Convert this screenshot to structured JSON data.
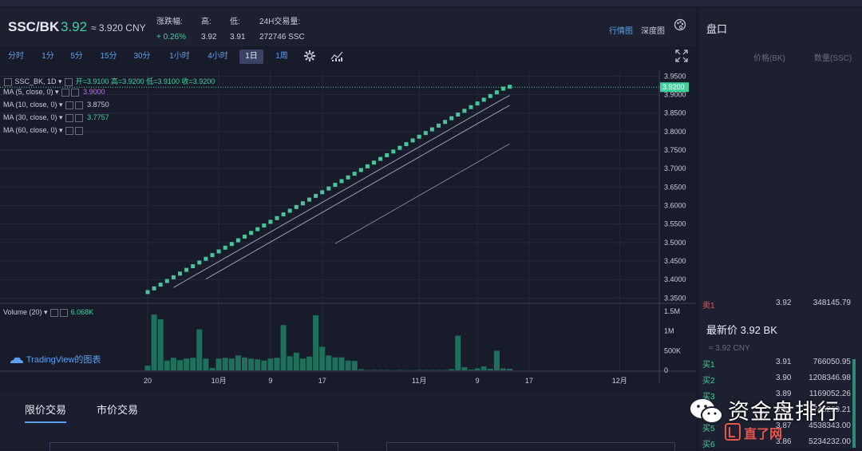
{
  "header": {
    "pair": "SSC/BK",
    "last_price": "3.92",
    "cny": "≈ 3.920 CNY",
    "stats": [
      {
        "k": "涨跌幅:",
        "v": "+ 0.26%",
        "up": true,
        "x": 196
      },
      {
        "k": "高:",
        "v": "3.92",
        "x": 252
      },
      {
        "k": "低:",
        "v": "3.91",
        "x": 288
      },
      {
        "k": "24H交易量:",
        "v": "272746 SSC",
        "x": 325
      }
    ],
    "view_links": [
      {
        "label": "行情图",
        "active": true
      },
      {
        "label": "深度图",
        "active": false
      }
    ],
    "palette_icon": "palette-icon"
  },
  "timeframes": [
    "分时",
    "1分",
    "5分",
    "15分",
    "30分",
    "1小时",
    "4小时",
    "1日",
    "1周"
  ],
  "selected_timeframe": "1日",
  "legend": {
    "symbol": "SSC_BK, 1D",
    "ohlc": "开=3.9100  高=3.9200  低=3.9100  收=3.9200",
    "ma": [
      {
        "label": "MA (5, close, 0)",
        "value": "3.9000",
        "color": "#c06cf0"
      },
      {
        "label": "MA (10, close, 0)",
        "value": "3.8750",
        "color": "#c9ccd8"
      },
      {
        "label": "MA (30, close, 0)",
        "value": "3.7757",
        "color": "#3fd19c"
      },
      {
        "label": "MA (60, close, 0)",
        "value": ""
      }
    ],
    "volume_label": "Volume (20)",
    "volume_value": "6.068K"
  },
  "tradingview": "TradingView的图表",
  "chart_data": {
    "type": "candlestick",
    "price_axis": {
      "ticks": [
        "3.9500",
        "3.9000",
        "3.8500",
        "3.8000",
        "3.7500",
        "3.7000",
        "3.6500",
        "3.6000",
        "3.5500",
        "3.5000",
        "3.4500",
        "3.4000",
        "3.3500"
      ],
      "ylim": [
        3.34,
        3.955
      ]
    },
    "current_price_label": "3.9200",
    "volume_axis": {
      "ticks": [
        "1.5M",
        "1M",
        "500K",
        "0"
      ],
      "ylim": [
        0,
        1500000
      ]
    },
    "x_labels": [
      {
        "label": "20",
        "index": 0
      },
      {
        "label": "10月",
        "index": 11
      },
      {
        "label": "9",
        "index": 19
      },
      {
        "label": "17",
        "index": 27
      },
      {
        "label": "11月",
        "index": 42
      },
      {
        "label": "9",
        "index": 51
      },
      {
        "label": "17",
        "index": 59
      },
      {
        "label": "12月",
        "index": 73
      }
    ],
    "closes": [
      3.365,
      3.375,
      3.385,
      3.395,
      3.405,
      3.415,
      3.425,
      3.435,
      3.445,
      3.455,
      3.465,
      3.475,
      3.485,
      3.495,
      3.505,
      3.515,
      3.525,
      3.535,
      3.545,
      3.555,
      3.565,
      3.575,
      3.585,
      3.595,
      3.605,
      3.615,
      3.625,
      3.635,
      3.645,
      3.655,
      3.665,
      3.675,
      3.685,
      3.695,
      3.705,
      3.715,
      3.725,
      3.735,
      3.745,
      3.755,
      3.765,
      3.775,
      3.785,
      3.795,
      3.805,
      3.815,
      3.825,
      3.835,
      3.845,
      3.855,
      3.865,
      3.875,
      3.885,
      3.895,
      3.905,
      3.915,
      3.92
    ],
    "volumes": [
      120000,
      1420000,
      1300000,
      250000,
      320000,
      260000,
      300000,
      320000,
      1040000,
      300000,
      60000,
      300000,
      320000,
      300000,
      380000,
      330000,
      300000,
      280000,
      250000,
      300000,
      320000,
      1150000,
      360000,
      450000,
      300000,
      350000,
      1400000,
      600000,
      380000,
      330000,
      330000,
      250000,
      240000,
      30000,
      10000,
      10000,
      10000,
      10000,
      5000,
      10000,
      5000,
      5000,
      10000,
      10000,
      10000,
      10000,
      10000,
      30000,
      880000,
      80000,
      20000,
      50000,
      100000,
      40000,
      500000,
      50000,
      40000
    ]
  },
  "bottom": {
    "tabs": [
      "限价交易",
      "市价交易"
    ]
  },
  "orderbook": {
    "title": "盘口",
    "col_price": "价格(BK)",
    "col_qty": "数量(SSC)",
    "sell": [
      {
        "label": "卖1",
        "price": "3.92",
        "qty": "348145.79"
      }
    ],
    "last": "最新价 3.92 BK",
    "last_cny": "≈ 3.92 CNY",
    "buy": [
      {
        "label": "买1",
        "price": "3.91",
        "qty": "766050.95"
      },
      {
        "label": "买2",
        "price": "3.90",
        "qty": "1208346.98"
      },
      {
        "label": "买3",
        "price": "3.89",
        "qty": "1169052.26"
      },
      {
        "label": "买4",
        "price": "3.88",
        "qty": "1745269.21"
      },
      {
        "label": "买5",
        "price": "3.87",
        "qty": "4538343.00"
      },
      {
        "label": "买6",
        "price": "3.86",
        "qty": "5234232.00"
      }
    ]
  },
  "watermark": {
    "text": "资金盘排行",
    "logo": "直了网"
  }
}
